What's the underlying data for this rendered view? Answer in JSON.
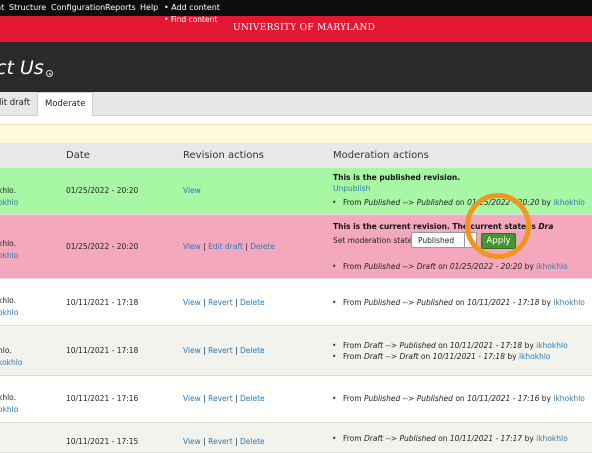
{
  "toolbar": {
    "items": [
      "nt",
      "Structure",
      "Configuration",
      "Reports",
      "Help"
    ],
    "add_content": "Add content",
    "find_content": "Find content"
  },
  "banner": {
    "title": "UNIVERSITY OF MARYLAND",
    "color": "#e21833"
  },
  "header": {
    "title": "ct Us"
  },
  "tabs": [
    {
      "label": "dit draft"
    },
    {
      "label": "Moderate",
      "active": true
    }
  ],
  "table": {
    "headers": [
      "Date",
      "Revision actions",
      "Moderation actions"
    ],
    "rows": [
      {
        "bg": "#a7f7a4",
        "revision_line1": "khlo.",
        "revision_line2": "okhlo",
        "date": "01/25/2022 - 20:20",
        "actions": [
          "View"
        ],
        "mod_title": "This is the published revision.",
        "mod_link": "Unpublish",
        "history": [
          {
            "from": "Published",
            "to": "Published",
            "when": "01/25/2022 - 20:20",
            "user": "ikhokhlo"
          }
        ]
      },
      {
        "bg": "#f4a8bd",
        "revision_line1": "khlo.",
        "revision_line2": "okhlo",
        "date": "01/25/2022 - 20:20",
        "actions": [
          "View",
          "Edit draft",
          "Delete"
        ],
        "mod_title": "This is the current revision. The current state is",
        "mod_title_state": "Dra",
        "set_state_label": "Set moderation state:",
        "select_value": "Published",
        "apply_label": "Apply",
        "history": [
          {
            "from": "Published",
            "to": "Draft",
            "when": "01/25/2022 - 20:20",
            "user": "ikhokhlo"
          }
        ]
      },
      {
        "bg": "#ffffff",
        "revision_line1": "khlo.",
        "revision_line2": "okhlo",
        "date": "10/11/2021 - 17:18",
        "actions": [
          "View",
          "Revert",
          "Delete"
        ],
        "history": [
          {
            "from": "Published",
            "to": "Published",
            "when": "10/11/2021 - 17:18",
            "user": "ikhokhlo"
          }
        ]
      },
      {
        "bg": "#f3f3ee",
        "revision_line1": "hlo.",
        "revision_line2": "kokhlo",
        "date": "10/11/2021 - 17:18",
        "actions": [
          "View",
          "Revert",
          "Delete"
        ],
        "history": [
          {
            "from": "Draft",
            "to": "Published",
            "when": "10/11/2021 - 17:18",
            "user": "ikhokhlo"
          },
          {
            "from": "Draft",
            "to": "Draft",
            "when": "10/11/2021 - 17:18",
            "user": "ikhokhlo"
          }
        ]
      },
      {
        "bg": "#ffffff",
        "revision_line1": "khlo.",
        "revision_line2": "okhlo",
        "date": "10/11/2021 - 17:16",
        "actions": [
          "View",
          "Revert",
          "Delete"
        ],
        "history": [
          {
            "from": "Published",
            "to": "Published",
            "when": "10/11/2021 - 17:16",
            "user": "ikhokhlo"
          }
        ]
      },
      {
        "bg": "#f3f3ee",
        "revision_line1": "",
        "revision_line2": "",
        "date": "10/11/2021 - 17:15",
        "actions": [
          "View",
          "Revert",
          "Delete"
        ],
        "history": [
          {
            "from": "Draft",
            "to": "Published",
            "when": "10/11/2021 - 17:17",
            "user": "ikhokhlo"
          }
        ]
      }
    ]
  },
  "colors": {
    "accent_highlight": "#f0961e",
    "link": "#2a7ab0",
    "apply_button": "#42952f"
  }
}
